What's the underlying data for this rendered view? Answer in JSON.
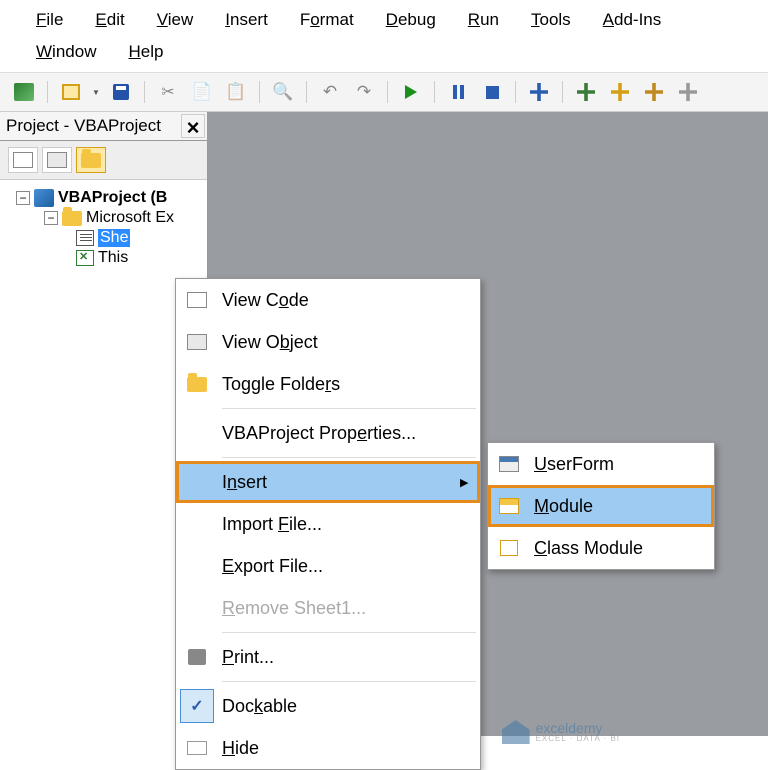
{
  "menubar": [
    {
      "pre": "",
      "ul": "F",
      "post": "ile"
    },
    {
      "pre": "",
      "ul": "E",
      "post": "dit"
    },
    {
      "pre": "",
      "ul": "V",
      "post": "iew"
    },
    {
      "pre": "",
      "ul": "I",
      "post": "nsert"
    },
    {
      "pre": "F",
      "ul": "o",
      "post": "rmat"
    },
    {
      "pre": "",
      "ul": "D",
      "post": "ebug"
    },
    {
      "pre": "",
      "ul": "R",
      "post": "un"
    },
    {
      "pre": "",
      "ul": "T",
      "post": "ools"
    },
    {
      "pre": "",
      "ul": "A",
      "post": "dd-Ins"
    },
    {
      "pre": "",
      "ul": "W",
      "post": "indow"
    },
    {
      "pre": "",
      "ul": "H",
      "post": "elp"
    }
  ],
  "project_panel": {
    "title": "Project - VBAProject",
    "tree": {
      "root": "VBAProject (B",
      "folder": "Microsoft Ex",
      "sheet": "She",
      "workbook": "This"
    }
  },
  "context_menu": [
    {
      "icon": "code",
      "pre": "View C",
      "ul": "o",
      "post": "de",
      "type": "item"
    },
    {
      "icon": "obj",
      "pre": "View O",
      "ul": "b",
      "post": "ject",
      "type": "item"
    },
    {
      "icon": "folder",
      "pre": "Toggle Folde",
      "ul": "r",
      "post": "s",
      "type": "item"
    },
    {
      "type": "sep"
    },
    {
      "icon": "",
      "pre": "VBAProject Prop",
      "ul": "e",
      "post": "rties...",
      "type": "item"
    },
    {
      "type": "sep"
    },
    {
      "icon": "",
      "pre": "I",
      "ul": "n",
      "post": "sert",
      "type": "submenu",
      "hl": true
    },
    {
      "icon": "",
      "pre": "Import ",
      "ul": "F",
      "post": "ile...",
      "type": "item"
    },
    {
      "icon": "",
      "pre": "",
      "ul": "E",
      "post": "xport File...",
      "type": "item"
    },
    {
      "icon": "",
      "pre": "",
      "ul": "R",
      "post": "emove Sheet1...",
      "type": "item",
      "disabled": true
    },
    {
      "type": "sep"
    },
    {
      "icon": "print",
      "pre": "",
      "ul": "P",
      "post": "rint...",
      "type": "item"
    },
    {
      "type": "sep"
    },
    {
      "icon": "check",
      "pre": "Doc",
      "ul": "k",
      "post": "able",
      "type": "item",
      "checked": true
    },
    {
      "icon": "blank",
      "pre": "",
      "ul": "H",
      "post": "ide",
      "type": "item"
    }
  ],
  "submenu": [
    {
      "icon": "uform",
      "pre": "",
      "ul": "U",
      "post": "serForm"
    },
    {
      "icon": "mod",
      "pre": "",
      "ul": "M",
      "post": "odule",
      "hl": true
    },
    {
      "icon": "class",
      "pre": "",
      "ul": "C",
      "post": "lass Module"
    }
  ],
  "watermark": {
    "brand": "exceldemy",
    "tag": "EXCEL · DATA · BI"
  }
}
